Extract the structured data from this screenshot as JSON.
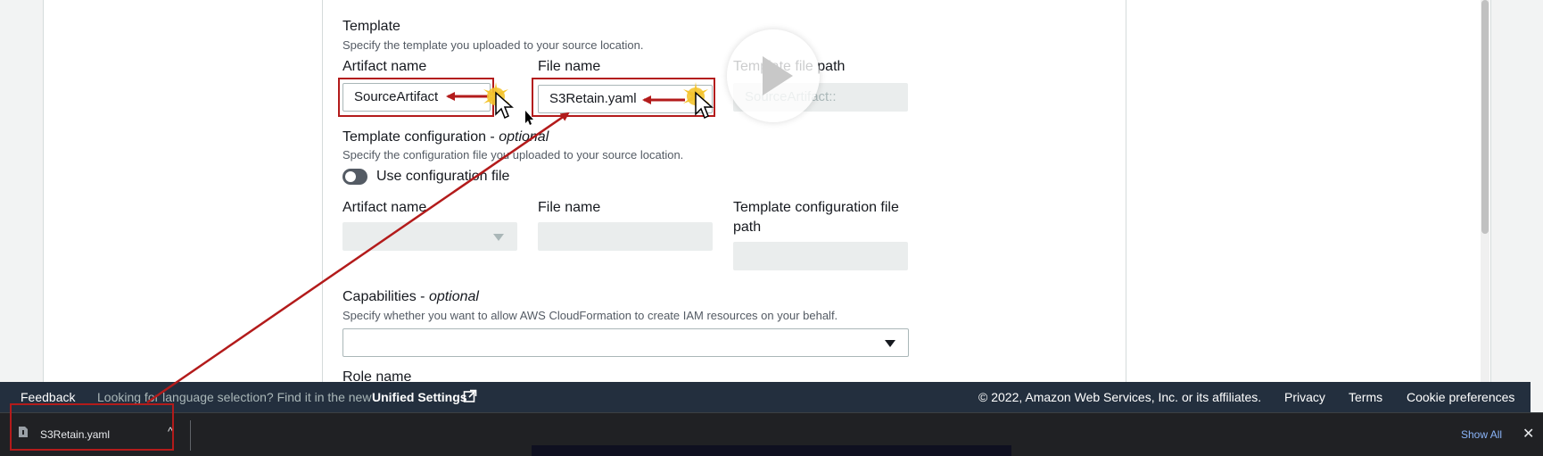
{
  "template": {
    "heading": "Template",
    "description": "Specify the template you uploaded to your source location.",
    "artifact_label": "Artifact name",
    "artifact_value": "SourceArtifact",
    "file_label": "File name",
    "file_value": "S3Retain.yaml",
    "path_label": "Template file path",
    "path_placeholder": "SourceArtifact::"
  },
  "template_config": {
    "heading": "Template configuration - ",
    "optional": "optional",
    "description": "Specify the configuration file you uploaded to your source location.",
    "toggle_label": "Use configuration file",
    "artifact_label": "Artifact name",
    "file_label": "File name",
    "path_label_line1": "Template configuration file",
    "path_label_line2": "path"
  },
  "capabilities": {
    "heading": "Capabilities - ",
    "optional": "optional",
    "description": "Specify whether you want to allow AWS CloudFormation to create IAM resources on your behalf."
  },
  "role": {
    "heading": "Role name"
  },
  "footer": {
    "feedback": "Feedback",
    "lang_prompt": "Looking for language selection? Find it in the new",
    "unified_settings": "Unified Settings",
    "copyright": "© 2022, Amazon Web Services, Inc. or its affiliates.",
    "privacy": "Privacy",
    "terms": "Terms",
    "cookie": "Cookie preferences"
  },
  "downloads": {
    "file": "S3Retain.yaml",
    "show_all": "Show All",
    "close": "✕"
  },
  "colors": {
    "annotation": "#b31b1b",
    "footer_bg": "#232f3e",
    "download_bar_bg": "#202124"
  }
}
